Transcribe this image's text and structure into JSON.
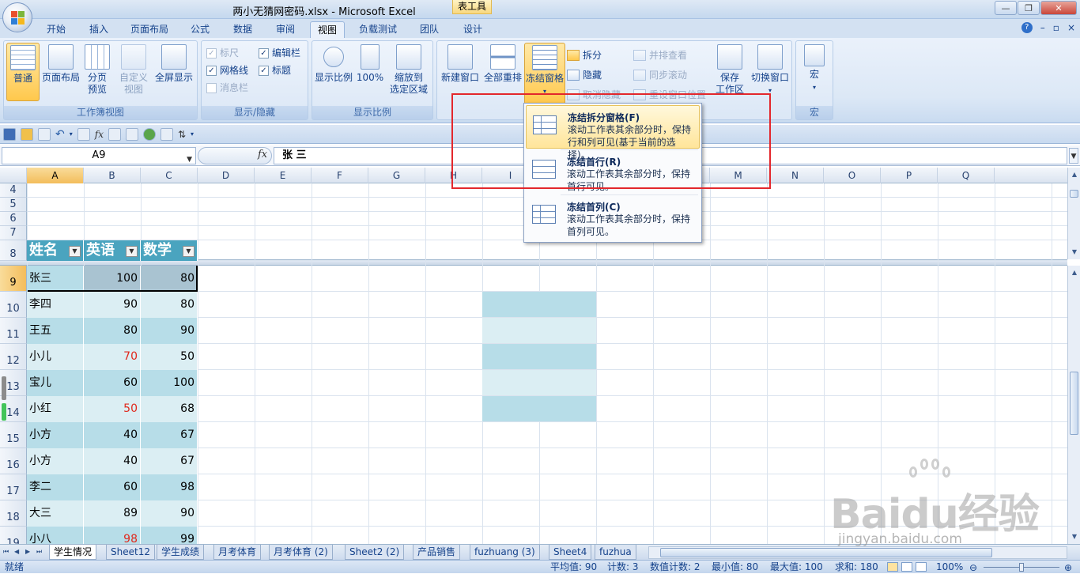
{
  "window": {
    "title": "两小无猜网密码.xlsx - Microsoft Excel",
    "context_tab_label": "表工具"
  },
  "tabs": [
    "开始",
    "插入",
    "页面布局",
    "公式",
    "数据",
    "审阅",
    "视图",
    "负载测试",
    "团队",
    "设计"
  ],
  "active_tab": "视图",
  "ribbon": {
    "workbook_views": {
      "label": "工作簿视图",
      "normal": "普通",
      "page_layout": "页面布局",
      "page_break_1": "分页",
      "page_break_2": "预览",
      "custom_1": "自定义",
      "custom_2": "视图",
      "full_screen": "全屏显示"
    },
    "show_hide": {
      "label": "显示/隐藏",
      "ruler": "标尺",
      "formula_bar": "编辑栏",
      "gridlines": "网格线",
      "headings": "标题",
      "message_bar": "消息栏"
    },
    "zoom": {
      "label": "显示比例",
      "zoom": "显示比例",
      "hundred": "100%",
      "fit_1": "缩放到",
      "fit_2": "选定区域"
    },
    "window": {
      "new_window": "新建窗口",
      "arrange_all": "全部重排",
      "freeze_panes": "冻结窗格",
      "split": "拆分",
      "hide": "隐藏",
      "unhide": "取消隐藏",
      "side_by_side": "并排查看",
      "sync_scroll": "同步滚动",
      "reset_position": "重设窗口位置",
      "save_ws_1": "保存",
      "save_ws_2": "工作区",
      "switch_windows": "切换窗口"
    },
    "macros": {
      "label": "宏",
      "button": "宏"
    }
  },
  "freeze_menu": {
    "items": [
      {
        "title": "冻结拆分窗格(F)",
        "desc": "滚动工作表其余部分时，保持行和列可见(基于当前的选择)。"
      },
      {
        "title": "冻结首行(R)",
        "desc": "滚动工作表其余部分时，保持首行可见。"
      },
      {
        "title": "冻结首列(C)",
        "desc": "滚动工作表其余部分时，保持首列可见。"
      }
    ]
  },
  "formula_bar": {
    "name_box": "A9",
    "fx": "fx",
    "content": "张 三"
  },
  "columns": [
    "A",
    "B",
    "C",
    "D",
    "E",
    "F",
    "G",
    "H",
    "I",
    "J",
    "K",
    "L",
    "M",
    "N",
    "O",
    "P",
    "Q"
  ],
  "top_rows": [
    "4",
    "5",
    "6",
    "7",
    "8"
  ],
  "table_headers": [
    "姓名",
    "英语",
    "数学"
  ],
  "rows": [
    {
      "num": "9",
      "name": "张三",
      "en": "100",
      "math": "80"
    },
    {
      "num": "10",
      "name": "李四",
      "en": "90",
      "math": "80"
    },
    {
      "num": "11",
      "name": "王五",
      "en": "80",
      "math": "90"
    },
    {
      "num": "12",
      "name": "小儿",
      "en": "70",
      "math": "50"
    },
    {
      "num": "13",
      "name": "宝儿",
      "en": "60",
      "math": "100"
    },
    {
      "num": "14",
      "name": "小红",
      "en": "50",
      "math": "68"
    },
    {
      "num": "15",
      "name": "小方",
      "en": "40",
      "math": "67"
    },
    {
      "num": "16",
      "name": "小方",
      "en": "40",
      "math": "67"
    },
    {
      "num": "17",
      "name": "李二",
      "en": "60",
      "math": "98"
    },
    {
      "num": "18",
      "name": "大三",
      "en": "89",
      "math": "90"
    },
    {
      "num": "19",
      "name": "小八",
      "en": "98",
      "math": "99"
    }
  ],
  "red_values": [
    "70",
    "50",
    "98"
  ],
  "sheets": [
    "学生情况",
    "Sheet12",
    "学生成绩",
    "月考体育",
    "月考体育 (2)",
    "Sheet2 (2)",
    "产品销售",
    "fuzhuang (3)",
    "Sheet4",
    "fuzhua"
  ],
  "active_sheet": "学生情况",
  "status": {
    "ready": "就绪",
    "average": "平均值: 90",
    "count": "计数: 3",
    "numeric_count": "数值计数: 2",
    "min": "最小值: 80",
    "max": "最大值: 100",
    "sum": "求和: 180",
    "zoom": "100%"
  },
  "watermark": {
    "brand": "Baidu经验",
    "url": "jingyan.baidu.com"
  },
  "colors": {
    "table_header": "#4aa4bf",
    "band_dark": "#b7dde8",
    "band_light": "#dbeef3",
    "selected": "#a9c3d1",
    "highlight_red": "#e3272c"
  }
}
